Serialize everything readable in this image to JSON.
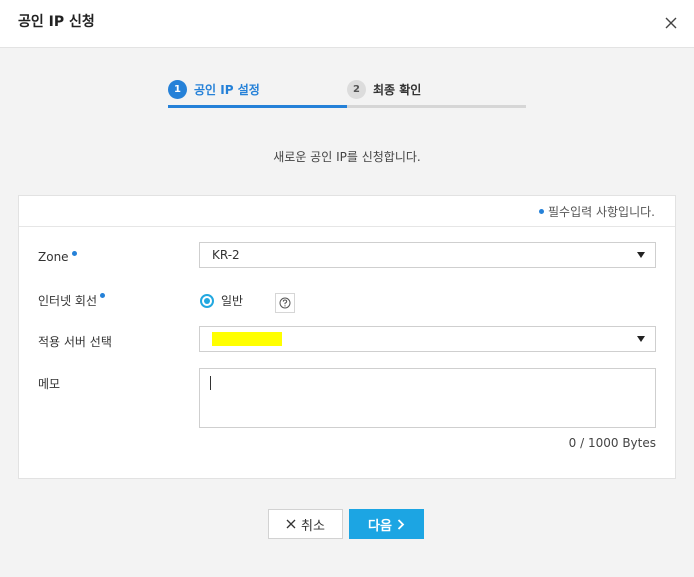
{
  "dialog": {
    "title": "공인 IP 신청"
  },
  "steps": [
    {
      "number": "1",
      "label": "공인 IP 설정"
    },
    {
      "number": "2",
      "label": "최종 확인"
    }
  ],
  "description": "새로운 공인 IP를 신청합니다.",
  "required_note": "필수입력 사항입니다.",
  "form": {
    "zone": {
      "label": "Zone",
      "value": "KR-2"
    },
    "internet_line": {
      "label": "인터넷 회선",
      "option": "일반"
    },
    "server": {
      "label": "적용 서버 선택",
      "value": ""
    },
    "memo": {
      "label": "메모",
      "value": "",
      "counter": "0 / 1000 Bytes"
    }
  },
  "buttons": {
    "cancel": "취소",
    "next": "다음"
  },
  "colors": {
    "accent": "#2581d8",
    "primary_button": "#1ca5e3",
    "radio": "#22a8e0",
    "redaction": "#ffff00"
  }
}
